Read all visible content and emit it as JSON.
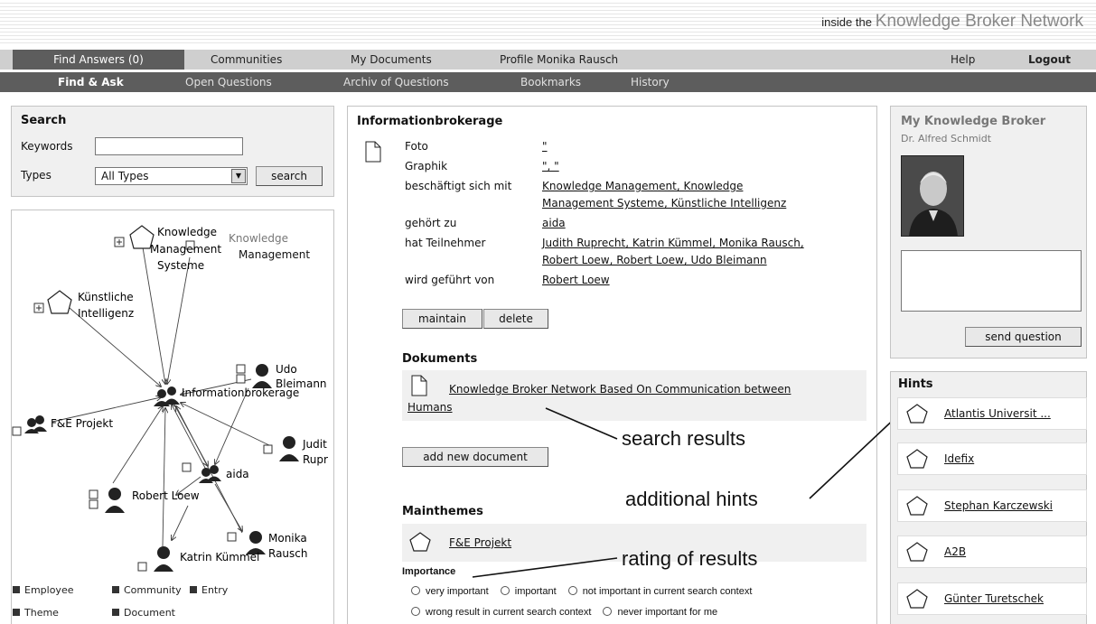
{
  "brand": {
    "prefix": "inside the",
    "name": "Knowledge Broker Network"
  },
  "nav_primary": [
    {
      "label": "Find Answers (0)"
    },
    {
      "label": "Communities"
    },
    {
      "label": "My Documents"
    },
    {
      "label": "Profile Monika Rausch"
    },
    {
      "label": "Help"
    },
    {
      "label": "Logout"
    }
  ],
  "nav_secondary": [
    {
      "label": "Find & Ask"
    },
    {
      "label": "Open Questions"
    },
    {
      "label": "Archiv of Questions"
    },
    {
      "label": "Bookmarks"
    },
    {
      "label": "History"
    }
  ],
  "search": {
    "title": "Search",
    "keywords_label": "Keywords",
    "keywords_value": "",
    "types_label": "Types",
    "types_selected": "All Types",
    "button": "search"
  },
  "graph": {
    "nodes": {
      "km_systeme": [
        "Knowledge",
        "Management",
        "Systeme"
      ],
      "km": [
        "Knowledge",
        "Management"
      ],
      "ki": [
        "Künstliche",
        "Intelligenz"
      ],
      "udo": [
        "Udo",
        "Bleimann"
      ],
      "info": "Informationbrokerage",
      "fe": "F&E Projekt",
      "judit": [
        "Judit",
        "Rupr"
      ],
      "aida": "aida",
      "robert": "Robert Loew",
      "monika": [
        "Monika",
        "Rausch"
      ],
      "katrin": "Katrin Kümmel"
    },
    "legend": [
      "Employee",
      "Community",
      "Entry",
      "Theme",
      "Document"
    ]
  },
  "main": {
    "title": "Informationbrokerage",
    "props": [
      {
        "label": "Foto",
        "value": "\""
      },
      {
        "label": "Graphik",
        "value": "\", \""
      },
      {
        "label": "beschäftigt sich mit",
        "value": "Knowledge Management, Knowledge",
        "value2": "Management Systeme, Künstliche Intelligenz"
      },
      {
        "label": "gehört zu",
        "value": "aida"
      },
      {
        "label": "hat Teilnehmer",
        "value": "Judith Ruprecht, Katrin Kümmel, Monika Rausch,",
        "value2": "Robert Loew, Robert Loew, Udo Bleimann"
      },
      {
        "label": "wird geführt von",
        "value": "Robert Loew"
      }
    ],
    "maintain_button": "maintain",
    "delete_button": "delete",
    "documents_title": "Dokuments",
    "document_link_1": "Knowledge Broker Network Based On Communication between",
    "document_link_2": "Humans",
    "add_document_button": "add new document",
    "mainthemes_title": "Mainthemes",
    "theme_link": "F&E Projekt",
    "importance_title": "Importance",
    "importance_options": [
      "very important",
      "important",
      "not important in current search context",
      "wrong result in current search context",
      "never important for me"
    ]
  },
  "annotations": {
    "search_results": "search results",
    "additional_hints": "additional hints",
    "rating": "rating of results"
  },
  "broker": {
    "title": "My Knowledge Broker",
    "name": "Dr. Alfred Schmidt",
    "question_text": "",
    "send_button": "send question"
  },
  "hints": {
    "title": "Hints",
    "items": [
      "Atlantis Universit ...",
      "Idefix",
      "Stephan Karczewski",
      "A2B",
      "Günter Turetschek"
    ]
  },
  "colors": {
    "nav_dark": "#5d5d5d",
    "nav_light": "#cfcfcf",
    "panel_bg": "#f0f0f0"
  }
}
